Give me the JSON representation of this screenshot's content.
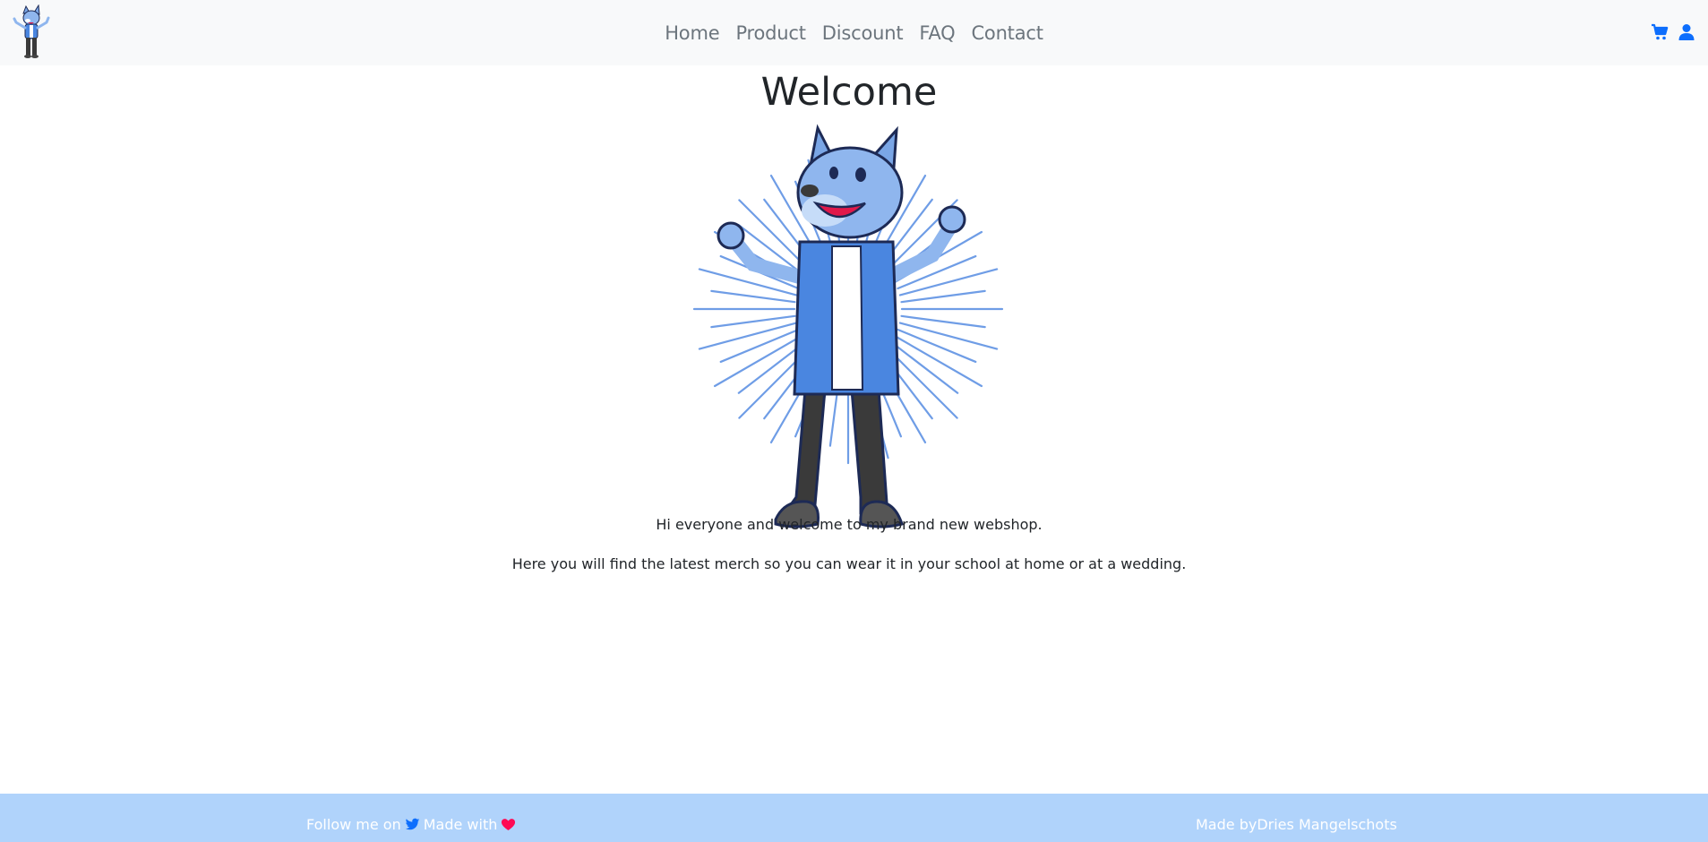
{
  "navbar": {
    "brand_logo": "wolf-mascot-logo",
    "links": [
      "Home",
      "Product",
      "Discount",
      "FAQ",
      "Contact"
    ],
    "icons": [
      "cart-icon",
      "user-icon"
    ],
    "icon_color": "#0d6efd"
  },
  "main": {
    "title": "Welcome",
    "hero_image": "wolf-mascot-illustration",
    "paragraphs": [
      "Hi everyone and welcome to my brand new webshop.",
      "Here you will find the latest merch so you can wear it in your school at home or at a wedding."
    ]
  },
  "footer": {
    "follow_text": "Follow me on",
    "follow_icon": "twitter-icon",
    "made_with_text": "Made with",
    "heart_icon": "heart-icon",
    "made_by_text": "Made by",
    "author": "Dries Mangelschots",
    "background": "#b0d3fb"
  }
}
